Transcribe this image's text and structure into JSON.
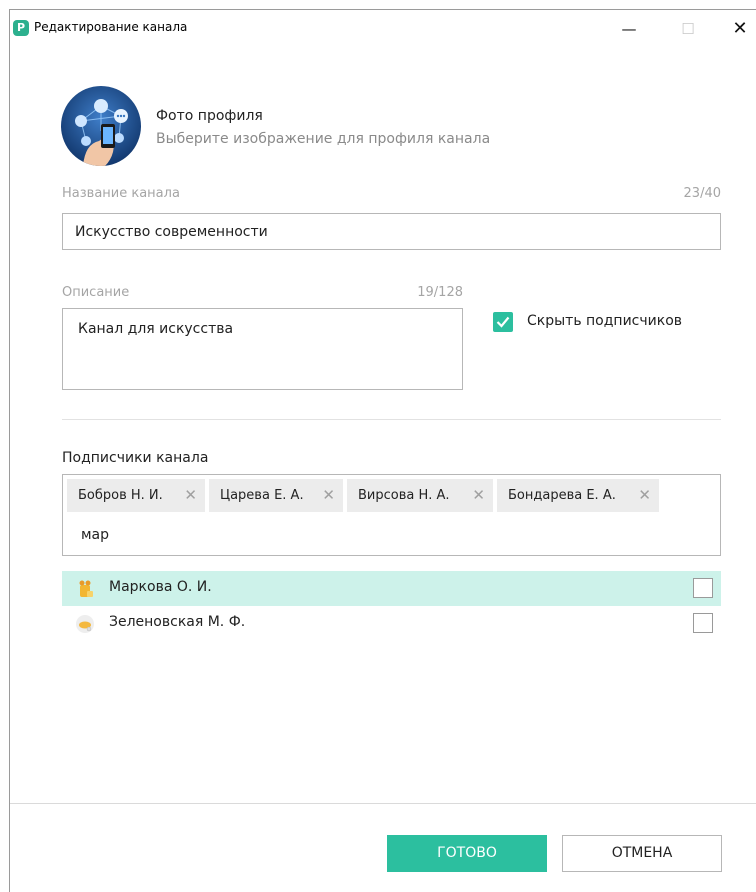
{
  "window": {
    "title": "Редактирование канала",
    "icon_letter": "P",
    "controls": {
      "minimize": "—",
      "maximize": "☐",
      "close": "✕"
    }
  },
  "profile": {
    "photo_title": "Фото профиля",
    "photo_subtitle": "Выберите изображение для профиля канала"
  },
  "name_field": {
    "label": "Название канала",
    "counter": "23/40",
    "value": "Искусство современности"
  },
  "description_field": {
    "label": "Описание",
    "counter": "19/128",
    "value": "Канал для искусства"
  },
  "hide_subscribers": {
    "label": "Скрыть подписчиков",
    "checked": true
  },
  "subscribers": {
    "label": "Подписчики канала",
    "tags": [
      "Бобров Н. И.",
      "Царева Е. А.",
      "Вирсова Н. А.",
      "Бондарева Е. А."
    ],
    "tag_remove_icon": "✕",
    "search_value": "мар"
  },
  "results": [
    {
      "name": "Маркова О. И.",
      "highlighted": true,
      "checked": false
    },
    {
      "name": "Зеленовская М. Ф.",
      "highlighted": false,
      "checked": false
    }
  ],
  "buttons": {
    "ok": "ГОТОВО",
    "cancel": "ОТМЕНА"
  },
  "colors": {
    "accent": "#2cbf9f",
    "highlight_row": "#cdf2ea"
  }
}
